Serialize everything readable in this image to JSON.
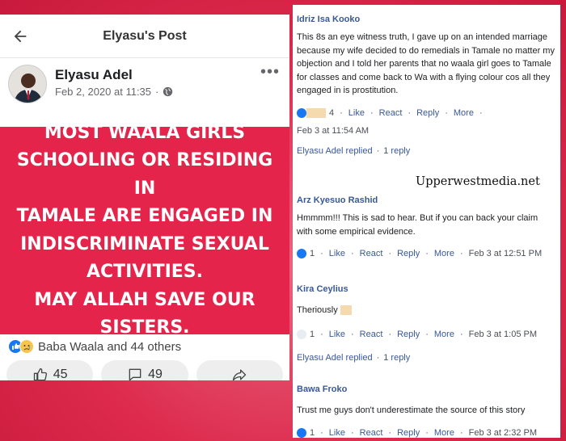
{
  "post": {
    "header_title": "Elyasu's Post",
    "author_name": "Elyasu Adel",
    "timestamp": "Feb 2, 2020 at 11:35",
    "meta_separator": "·",
    "more_label": "•••",
    "banner_lines": [
      "MOST WAALA GIRLS",
      "SCHOOLING OR RESIDING IN",
      "TAMALE ARE ENGAGED IN",
      "INDISCRIMINATE SEXUAL",
      "ACTIVITIES.",
      "MAY ALLAH SAVE OUR",
      "SISTERS."
    ],
    "banner_color": "#e4244a",
    "reactions_text": "Baba Waala and 44 others",
    "like_count": "45",
    "comment_count": "49",
    "icons": [
      "back-arrow-icon",
      "globe-icon",
      "like-reaction-icon",
      "sad-reaction-icon",
      "thumbs-up-icon",
      "comment-bubble-icon",
      "share-icon"
    ]
  },
  "comments": [
    {
      "author": "Idriz Isa Kooko",
      "text": "This 8s an eye witness truth, I gave up on an intended marriage because my wife decided to do remedials in Tamale no matter my objection and I told her parents that no waala girl goes to Tamale for classes and come back to Wa with a flying colour cos all they engaged in is prostitution.",
      "count": "4",
      "like": "Like",
      "react": "React",
      "reply": "Reply",
      "more": "More",
      "time": "Feb 3 at 11:54 AM",
      "replied_by": "Elyasu Adel replied",
      "replied_count": "1 reply"
    },
    {
      "author": "Arz Kyesuo Rashid",
      "text": "Hmmmm!!! This is sad to hear. But if you can back your claim with some empirical evidence.",
      "count": "1",
      "like": "Like",
      "react": "React",
      "reply": "Reply",
      "more": "More",
      "time": "Feb 3 at 12:51 PM"
    },
    {
      "author": "Kira Ceylius",
      "text": "Theriously",
      "count": "1",
      "like": "Like",
      "react": "React",
      "reply": "Reply",
      "more": "More",
      "time": "Feb 3 at 1:05 PM",
      "replied_by": "Elyasu Adel replied",
      "replied_count": "1 reply"
    },
    {
      "author": "Bawa Froko",
      "text": "Trust me guys don't underestimate the source of this story",
      "count": "1",
      "like": "Like",
      "react": "React",
      "reply": "Reply",
      "more": "More",
      "time": "Feb 3 at 2:32 PM"
    }
  ],
  "separator": "·",
  "watermark": "Upperwestmedia.net",
  "colors": {
    "background": "#dd2a4d",
    "link_blue": "#385898",
    "fb_blue": "#1877f2"
  }
}
